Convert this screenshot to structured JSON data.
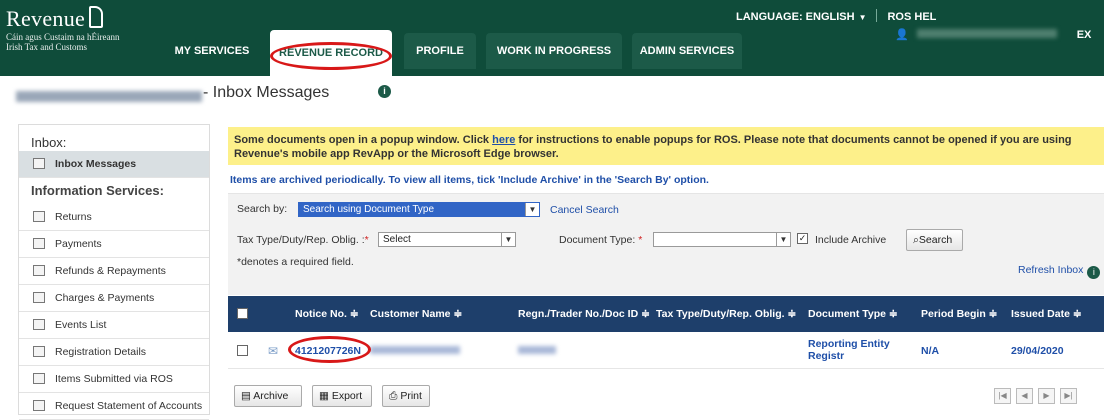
{
  "brand": {
    "title": "Revenue",
    "subtitle1": "Cáin agus Custaim na hÉireann",
    "subtitle2": "Irish Tax and Customs"
  },
  "nav": {
    "tabs": [
      "MY SERVICES",
      "REVENUE RECORD",
      "PROFILE",
      "WORK IN PROGRESS",
      "ADMIN SERVICES"
    ],
    "active": "REVENUE RECORD"
  },
  "header": {
    "language_label": "LANGUAGE: ENGLISH",
    "ros_help": "ROS HEL",
    "exit": "EX"
  },
  "page": {
    "title": "- Inbox Messages",
    "info": "i"
  },
  "sidebar": {
    "inbox_heading": "Inbox:",
    "inbox_item": "Inbox Messages",
    "info_heading": "Information Services:",
    "items": [
      "Returns",
      "Payments",
      "Refunds & Repayments",
      "Charges & Payments",
      "Events List",
      "Registration Details",
      "Items Submitted via ROS",
      "Request Statement of Accounts"
    ]
  },
  "notice": {
    "text_before": "Some documents open in a popup window. Click ",
    "link": "here",
    "text_after": " for instructions to enable popups for ROS. Please note that documents cannot be opened if you are using Revenue's mobile app RevApp or the Microsoft Edge browser."
  },
  "archive_note": "Items are archived periodically. To view all items, tick 'Include Archive' in the 'Search By' option.",
  "search": {
    "search_by_label": "Search by:",
    "search_by_value": "Search using Document Type",
    "cancel": "Cancel Search",
    "tax_type_label": "Tax Type/Duty/Rep. Oblig. :",
    "tax_type_value": "Select",
    "doc_type_label": "Document Type:",
    "doc_type_value": "",
    "include_archive": "Include Archive",
    "search_button": "Search",
    "required_note": "*denotes a required field.",
    "refresh": "Refresh Inbox"
  },
  "table": {
    "headers": [
      "Notice No. ≑",
      "Customer Name ≑",
      "Regn./Trader No./Doc ID ≑",
      "Tax Type/Duty/Rep. Oblig. ≑",
      "Document Type ≑",
      "Period Begin ≑",
      "Issued Date ≑"
    ],
    "rows": [
      {
        "notice_no": "4121207726N",
        "document_type": "Reporting Entity Registr",
        "period_begin": "N/A",
        "issued_date": "29/04/2020"
      }
    ]
  },
  "footer": {
    "archive": "Archive",
    "export": "Export",
    "print": "Print"
  },
  "colors": {
    "header_green": "#0f4c3a",
    "table_header": "#1e3f6b",
    "notice_yellow": "#fdf08a",
    "highlight_red": "#d81818"
  }
}
